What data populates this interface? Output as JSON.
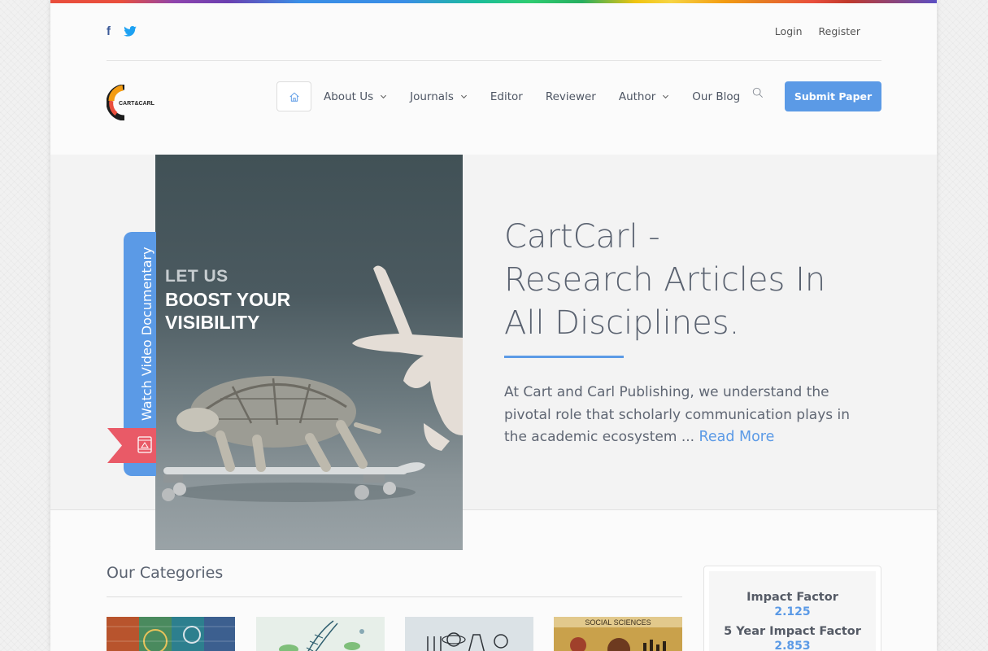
{
  "header": {
    "social": [
      "facebook-icon",
      "twitter-icon"
    ],
    "login_label": "Login",
    "register_label": "Register"
  },
  "logo": {
    "text": "CART&CARL"
  },
  "nav": {
    "items": [
      {
        "label": "About Us",
        "dropdown": true
      },
      {
        "label": "Journals",
        "dropdown": true
      },
      {
        "label": "Editor",
        "dropdown": false
      },
      {
        "label": "Reviewer",
        "dropdown": false
      },
      {
        "label": "Author",
        "dropdown": true
      },
      {
        "label": "Our Blog",
        "dropdown": false
      }
    ],
    "submit_label": "Submit Paper"
  },
  "hero": {
    "poster_line1": "LET US",
    "poster_line2": "BOOST YOUR",
    "poster_line3": "VISIBILITY",
    "video_label": "Watch Video Documentary",
    "title_line1": "CartCarl -",
    "title_line2": "Research Articles In",
    "title_line3": "All Disciplines.",
    "description": "At Cart and Carl Publishing, we understand the pivotal role that scholarly communication plays in the academic ecosystem ...",
    "read_more": "Read More"
  },
  "categories": {
    "title": "Our Categories",
    "thumb4_label": "SOCIAL SCIENCES"
  },
  "impact": {
    "label1": "Impact Factor",
    "value1": "2.125",
    "label2": "5 Year Impact Factor",
    "value2": "2.853"
  },
  "colors": {
    "accent": "#5b9ae6",
    "ribbon": "#e95a67"
  }
}
